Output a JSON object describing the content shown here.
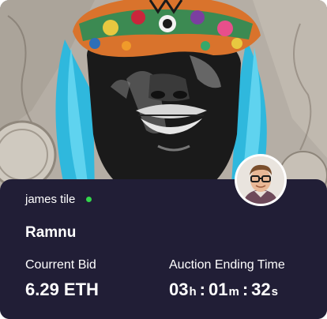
{
  "card": {
    "owner": {
      "name": "james tile",
      "online": true,
      "status_color": "#32d74b"
    },
    "title": "Ramnu",
    "current_bid": {
      "label": "Courrent Bid",
      "value": "6.29 ETH"
    },
    "auction": {
      "label": "Auction Ending Time",
      "hours": "03",
      "hours_unit": "h",
      "minutes": "01",
      "minutes_unit": "m",
      "seconds": "32",
      "seconds_unit": "s",
      "separator": ":"
    }
  },
  "theme": {
    "panel": "#211e36",
    "hair": "#2fb8dd",
    "accent": "#32d74b"
  },
  "icons": {
    "avatar": "user-avatar",
    "online": "online-dot"
  }
}
